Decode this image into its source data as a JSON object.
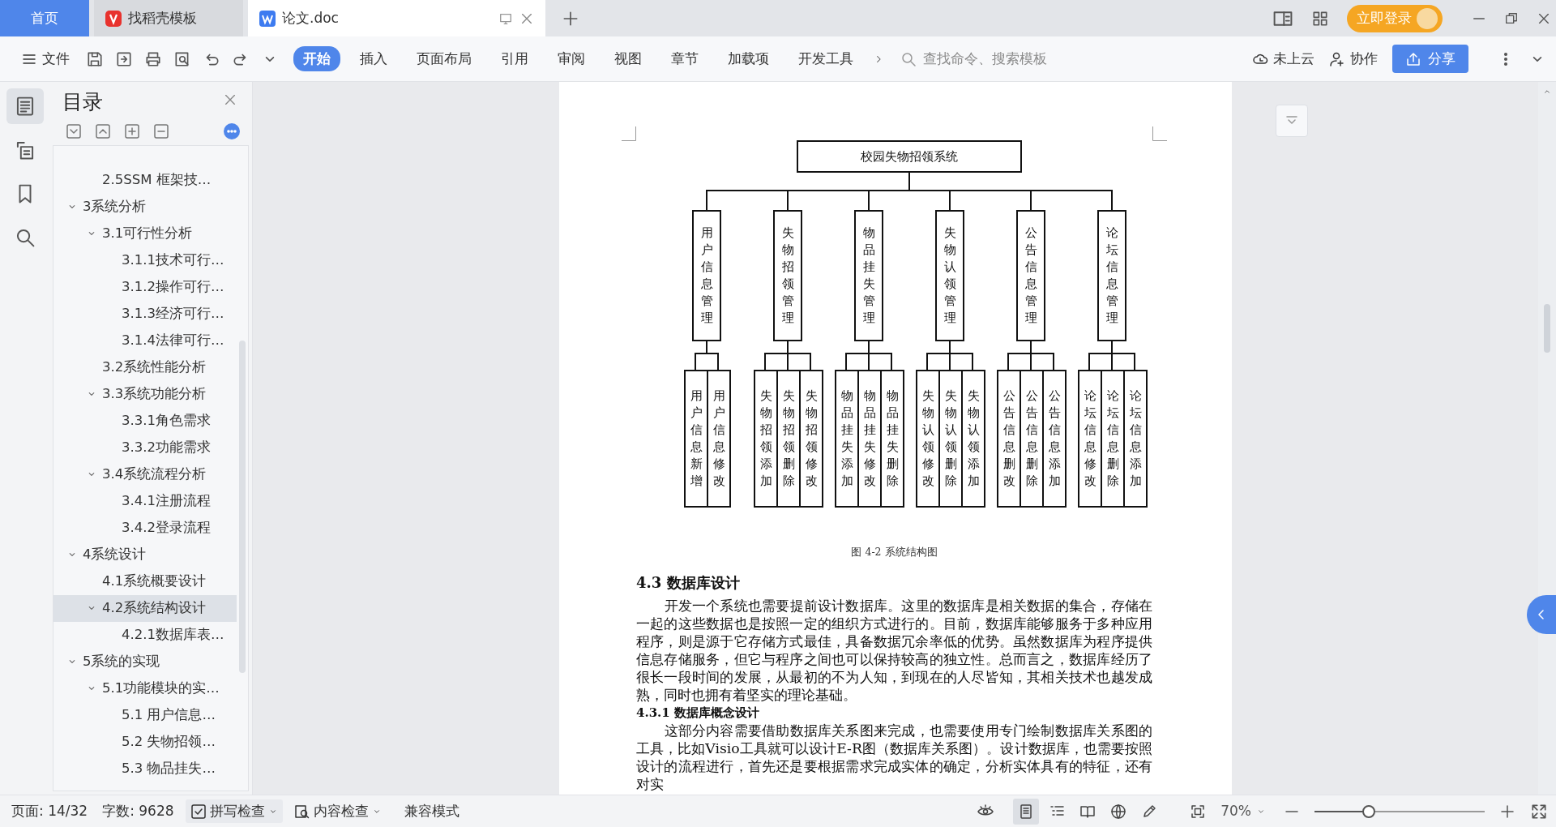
{
  "tabs": [
    {
      "kind": "home",
      "label": "首页",
      "selected": false
    },
    {
      "kind": "template",
      "label": "找稻壳模板",
      "selected": false
    },
    {
      "kind": "document",
      "label": "论文.doc",
      "selected": true
    }
  ],
  "account": {
    "login": "立即登录"
  },
  "toolbar": {
    "file_menu": "文件",
    "ribbon_tabs": [
      {
        "label": "开始",
        "selected": true
      },
      {
        "label": "插入",
        "selected": false
      },
      {
        "label": "页面布局",
        "selected": false
      },
      {
        "label": "引用",
        "selected": false
      },
      {
        "label": "审阅",
        "selected": false
      },
      {
        "label": "视图",
        "selected": false
      },
      {
        "label": "章节",
        "selected": false
      },
      {
        "label": "加载项",
        "selected": false
      },
      {
        "label": "开发工具",
        "selected": false
      }
    ],
    "search": {
      "placeholder": "查找命令、搜索模板"
    },
    "cloud_status": "未上云",
    "collaborate": "协作",
    "share": "分享"
  },
  "rail": [
    {
      "kind": "toc",
      "selected": true
    },
    {
      "kind": "navigation",
      "selected": false
    },
    {
      "kind": "bookmark",
      "selected": false
    },
    {
      "kind": "find",
      "selected": false
    }
  ],
  "toc": {
    "title": "目录",
    "items": [
      {
        "children": [
          {
            "label": "2.5SSM 框架技…",
            "selected": false
          }
        ]
      },
      {
        "label": "3系统分析",
        "selected": false,
        "expanded": true,
        "children": [
          {
            "label": "3.1可行性分析",
            "selected": false,
            "expanded": true,
            "children": [
              {
                "label": "3.1.1技术可行…",
                "selected": false
              },
              {
                "label": "3.1.2操作可行…",
                "selected": false
              },
              {
                "label": "3.1.3经济可行…",
                "selected": false
              },
              {
                "label": "3.1.4法律可行…",
                "selected": false
              }
            ]
          },
          {
            "label": "3.2系统性能分析",
            "selected": false
          },
          {
            "label": "3.3系统功能分析",
            "selected": false,
            "expanded": true,
            "children": [
              {
                "label": "3.3.1角色需求",
                "selected": false
              },
              {
                "label": "3.3.2功能需求",
                "selected": false
              }
            ]
          },
          {
            "label": "3.4系统流程分析",
            "selected": false,
            "expanded": true,
            "children": [
              {
                "label": "3.4.1注册流程",
                "selected": false
              },
              {
                "label": "3.4.2登录流程",
                "selected": false
              }
            ]
          }
        ]
      },
      {
        "label": "4系统设计",
        "selected": false,
        "expanded": true,
        "children": [
          {
            "label": "4.1系统概要设计",
            "selected": false
          },
          {
            "label": "4.2系统结构设计",
            "selected": true,
            "expanded": true,
            "children": [
              {
                "label": "4.2.1数据库表…",
                "selected": false
              }
            ]
          }
        ]
      },
      {
        "label": "5系统的实现",
        "selected": false,
        "expanded": true,
        "children": [
          {
            "label": "5.1功能模块的实…",
            "selected": false,
            "expanded": true,
            "children": [
              {
                "label": "5.1 用户信息…",
                "selected": false
              },
              {
                "label": "5.2  失物招领…",
                "selected": false
              },
              {
                "label": "5.3 物品挂失…",
                "selected": false
              }
            ]
          }
        ]
      }
    ]
  },
  "document": {
    "diagram": {
      "label": "校园失物招领系统",
      "children": [
        {
          "label": "用户信息管理",
          "children": [
            {
              "label": "用户信息新增"
            },
            {
              "label": "用户信息修改"
            }
          ]
        },
        {
          "label": "失物招领管理",
          "children": [
            {
              "label": "失物招领添加"
            },
            {
              "label": "失物招领删除"
            },
            {
              "label": "失物招领修改"
            }
          ]
        },
        {
          "label": "物品挂失管理",
          "children": [
            {
              "label": "物品挂失添加"
            },
            {
              "label": "物品挂失修改"
            },
            {
              "label": "物品挂失删除"
            }
          ]
        },
        {
          "label": "失物认领管理",
          "children": [
            {
              "label": "失物认领修改"
            },
            {
              "label": "失物认领删除"
            },
            {
              "label": "失物认领添加"
            }
          ]
        },
        {
          "label": "公告信息管理",
          "children": [
            {
              "label": "公告信息删改"
            },
            {
              "label": "公告信息删除"
            },
            {
              "label": "公告信息添加"
            }
          ]
        },
        {
          "label": "论坛信息管理",
          "children": [
            {
              "label": "论坛信息修改"
            },
            {
              "label": "论坛信息删除"
            },
            {
              "label": "论坛信息添加"
            }
          ]
        }
      ]
    },
    "blocks": [
      {
        "kind": "caption",
        "text": "图 4-2  系统结构图"
      },
      {
        "kind": "heading",
        "text": "4.3  数据库设计"
      },
      {
        "kind": "paragraph",
        "text": "开发一个系统也需要提前设计数据库。这里的数据库是相关数据的集合，存储在一起的这些数据也是按照一定的组织方式进行的。目前，数据库能够服务于多种应用程序，则是源于它存储方式最佳，具备数据冗余率低的优势。虽然数据库为程序提供信息存储服务，但它与程序之间也可以保持较高的独立性。总而言之，数据库经历了很长一段时间的发展，从最初的不为人知，到现在的人尽皆知，其相关技术也越发成熟，同时也拥有着坚实的理论基础。"
      },
      {
        "kind": "subheading",
        "text": "4.3.1  数据库概念设计"
      },
      {
        "kind": "paragraph",
        "text": "这部分内容需要借助数据库关系图来完成，也需要使用专门绘制数据库关系图的工具，比如Visio工具就可以设计E-R图（数据库关系图）。设计数据库，也需要按照设计的流程进行，首先还是要根据需求完成实体的确定，分析实体具有的特征，还有对实"
      }
    ]
  },
  "status_bar": {
    "page": "页面: 14/32",
    "word_count": "字数: 9628",
    "spell_check": "拼写检查",
    "content_check": "内容检查",
    "compat_mode": "兼容模式",
    "view_modes": [
      {
        "kind": "page",
        "selected": true
      },
      {
        "kind": "outline",
        "selected": false
      },
      {
        "kind": "reading",
        "selected": false
      },
      {
        "kind": "web",
        "selected": false
      },
      {
        "kind": "writing",
        "selected": false
      }
    ],
    "zoom": {
      "reading": "70%",
      "level": 0.32
    }
  }
}
